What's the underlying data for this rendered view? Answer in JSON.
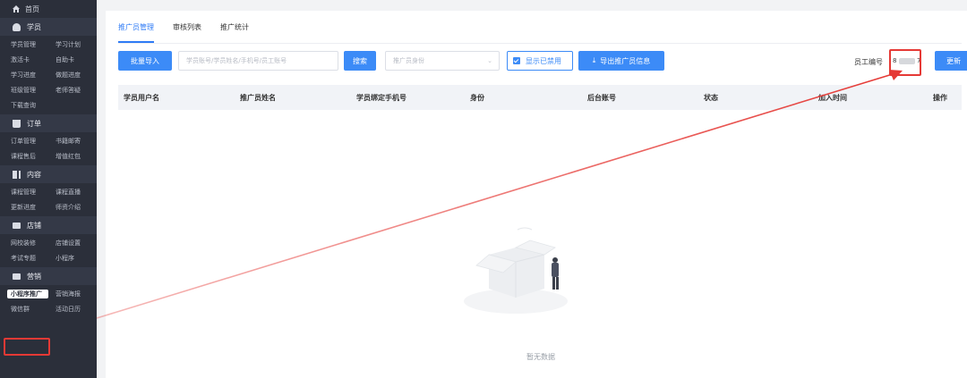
{
  "sidebar": {
    "home": "首页",
    "sections": [
      {
        "title": "学员",
        "icon": "person-icon",
        "rows": [
          [
            "学员管理",
            "学习计划"
          ],
          [
            "激活卡",
            "自助卡"
          ],
          [
            "学习进度",
            "做题进度"
          ],
          [
            "班级管理",
            "老师答疑"
          ],
          [
            "下载查询",
            ""
          ]
        ]
      },
      {
        "title": "订单",
        "icon": "bag-icon",
        "rows": [
          [
            "订单管理",
            "书籍邮寄"
          ],
          [
            "课程售后",
            "增值红包"
          ]
        ]
      },
      {
        "title": "内容",
        "icon": "chart-icon",
        "rows": [
          [
            "课程管理",
            "课程直播"
          ],
          [
            "更新进度",
            "师资介绍"
          ]
        ]
      },
      {
        "title": "店铺",
        "icon": "shop-icon",
        "rows": [
          [
            "网校装修",
            "店铺设置"
          ],
          [
            "考试专题",
            "小程序"
          ]
        ]
      },
      {
        "title": "营销",
        "icon": "marketing-icon",
        "rows": [
          [
            "小程序推广",
            "营销海报"
          ],
          [
            "微信群",
            "活动日历"
          ]
        ]
      }
    ]
  },
  "tabs": [
    "推广员管理",
    "审核列表",
    "推广统计"
  ],
  "toolbar": {
    "batch_import": "批量导入",
    "search_placeholder": "学员账号/学员姓名/手机号/员工账号",
    "search_button": "搜索",
    "identity_placeholder": "推广员身份",
    "show_disabled": "显示已禁用",
    "export": "导出推广员信息",
    "employee_label": "员工编号",
    "employee_value_start": "8",
    "employee_value_end": "7",
    "update": "更新"
  },
  "table": {
    "columns": [
      "学员用户名",
      "推广员姓名",
      "学员绑定手机号",
      "身份",
      "后台账号",
      "状态",
      "加入时间",
      "操作"
    ],
    "empty_text": "暂无数据"
  },
  "colors": {
    "accent": "#3c8bf7",
    "annotation": "#e53935",
    "sidebar_bg": "#2b2f3a"
  }
}
